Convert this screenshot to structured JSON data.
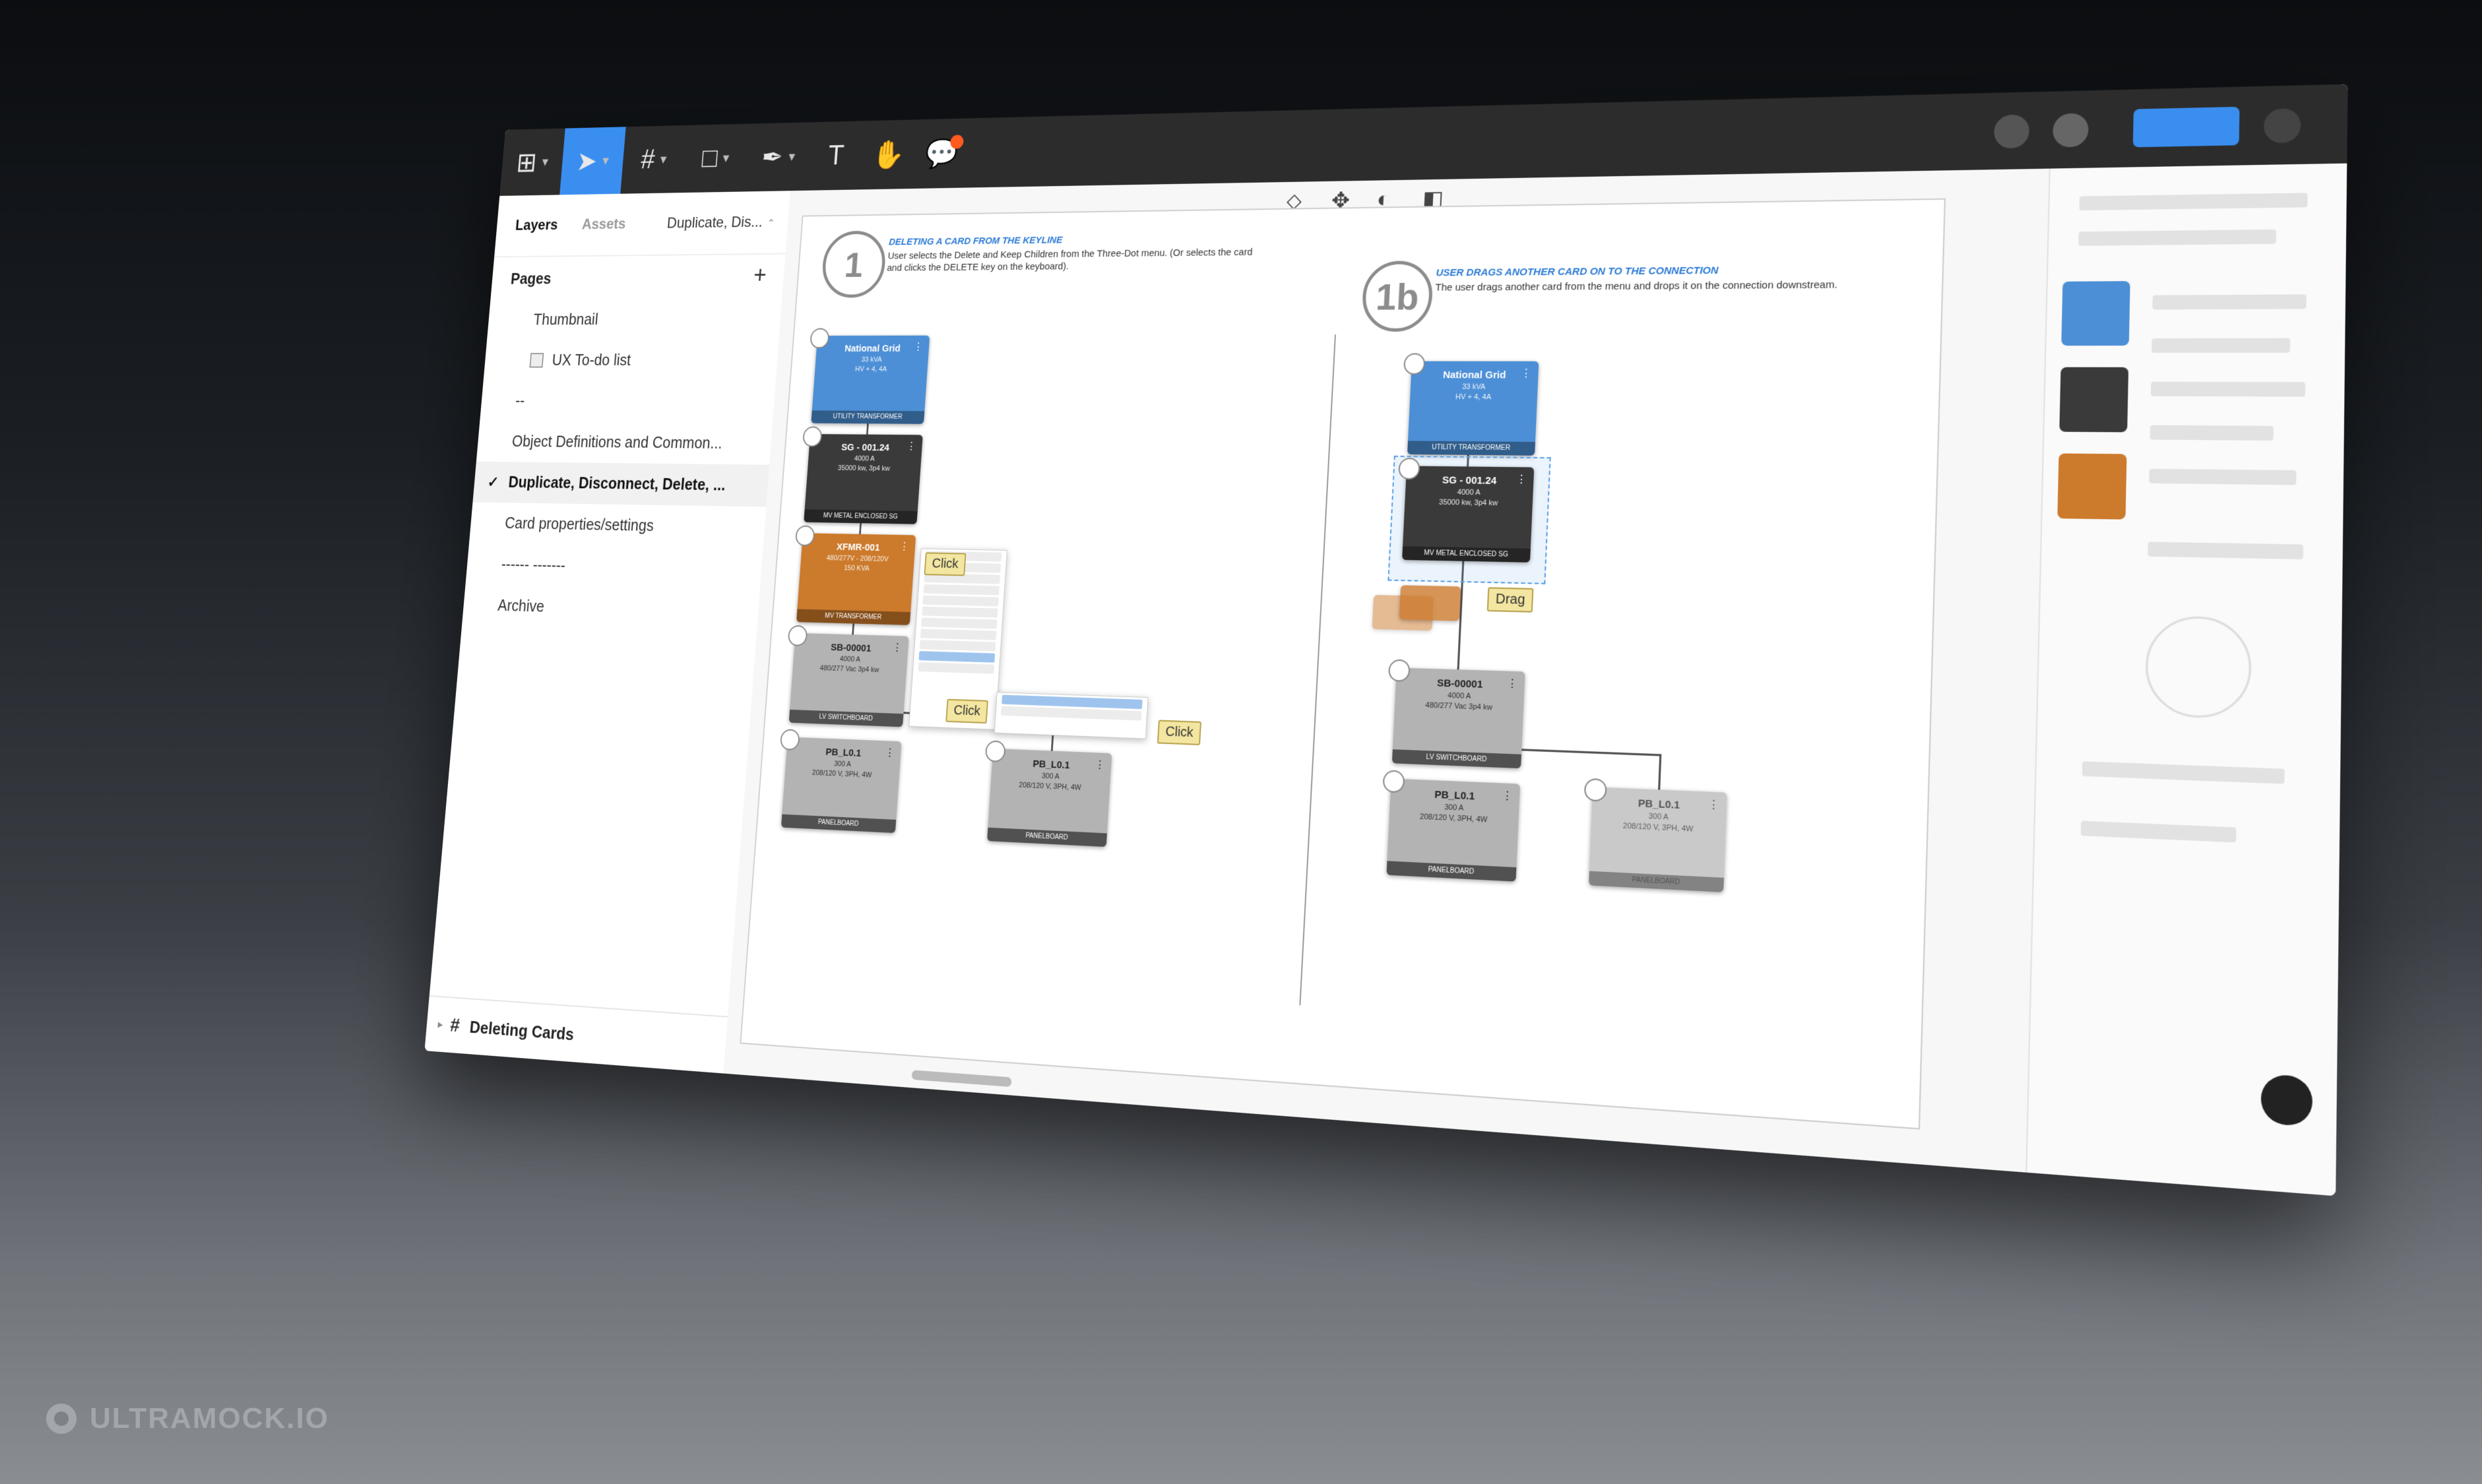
{
  "window": {
    "toolbar": {
      "tools": [
        {
          "name": "main-menu-icon",
          "glyph": "⊞"
        },
        {
          "name": "move-tool-icon",
          "glyph": "➤"
        },
        {
          "name": "frame-tool-icon",
          "glyph": "#"
        },
        {
          "name": "rectangle-tool-icon",
          "glyph": "□"
        },
        {
          "name": "pen-tool-icon",
          "glyph": "✒"
        },
        {
          "name": "text-tool-icon",
          "glyph": "T"
        },
        {
          "name": "hand-tool-icon",
          "glyph": "✋"
        },
        {
          "name": "comment-tool-icon",
          "glyph": "💬"
        }
      ]
    },
    "left_panel": {
      "tabs": [
        "Layers",
        "Assets"
      ],
      "active_tab": "Layers",
      "current_page": "Duplicate, Dis...",
      "pages_label": "Pages",
      "pages": [
        {
          "label": "Thumbnail"
        },
        {
          "label": "UX To-do list"
        },
        {
          "label": "--"
        },
        {
          "label": "Object Definitions and Common..."
        },
        {
          "label": "Duplicate, Disconnect, Delete, ..."
        },
        {
          "label": "Card properties/settings"
        },
        {
          "label": "------ -------"
        },
        {
          "label": "Archive"
        }
      ],
      "bottom_layer": "Deleting Cards"
    },
    "canvas": {
      "step1": {
        "number": "1",
        "heading": "Deleting a card from the keyline",
        "description": "User selects the Delete and Keep Children from the Three-Dot menu. (Or selects the card and clicks the DELETE key on the keyboard)."
      },
      "step1b": {
        "number": "1b",
        "heading": "User drags another card on to the connection",
        "description": "The user drags another card from the menu and drops it on the connection downstream."
      },
      "tooltips": {
        "click": "Click",
        "drag": "Drag"
      },
      "cards_left": [
        {
          "title": "National Grid",
          "l1": "33 kVA",
          "l2": "HV + 4, 4A",
          "footer": "UTILITY TRANSFORMER",
          "style": "c-blue"
        },
        {
          "title": "SG - 001.24",
          "l1": "4000 A",
          "l2": "35000 kw, 3p4 kw",
          "footer": "MV METAL ENCLOSED SG",
          "style": "c-dark"
        },
        {
          "title": "XFMR-001",
          "l1": "480/277V - 208/120V",
          "l2": "150 KVA",
          "footer": "MV TRANSFORMER",
          "style": "c-orange"
        },
        {
          "title": "SB-00001",
          "l1": "4000 A",
          "l2": "480/277 Vac 3p4 kw",
          "footer": "LV SWITCHBOARD",
          "style": "c-gray"
        },
        {
          "title": "PB_L0.1",
          "l1": "300 A",
          "l2": "208/120 V, 3PH, 4W",
          "footer": "PANELBOARD",
          "style": "c-gray"
        },
        {
          "title": "PB_L0.1",
          "l1": "300 A",
          "l2": "208/120 V, 3PH, 4W",
          "footer": "PANELBOARD",
          "style": "c-gray"
        }
      ],
      "cards_right": [
        {
          "title": "National Grid",
          "l1": "33 kVA",
          "l2": "HV + 4, 4A",
          "footer": "UTILITY TRANSFORMER",
          "style": "c-blue"
        },
        {
          "title": "SG - 001.24",
          "l1": "4000 A",
          "l2": "35000 kw, 3p4 kw",
          "footer": "MV METAL ENCLOSED SG",
          "style": "c-dark"
        },
        {
          "title": "SB-00001",
          "l1": "4000 A",
          "l2": "480/277 Vac 3p4 kw",
          "footer": "LV SWITCHBOARD",
          "style": "c-gray"
        },
        {
          "title": "PB_L0.1",
          "l1": "300 A",
          "l2": "208/120 V, 3PH, 4W",
          "footer": "PANELBOARD",
          "style": "c-gray"
        },
        {
          "title": "PB_L0.1",
          "l1": "300 A",
          "l2": "208/120 V, 3PH, 4W",
          "footer": "PANELBOARD",
          "style": "c-gray2"
        }
      ]
    }
  },
  "watermark": "ULTRAMOCK.IO"
}
